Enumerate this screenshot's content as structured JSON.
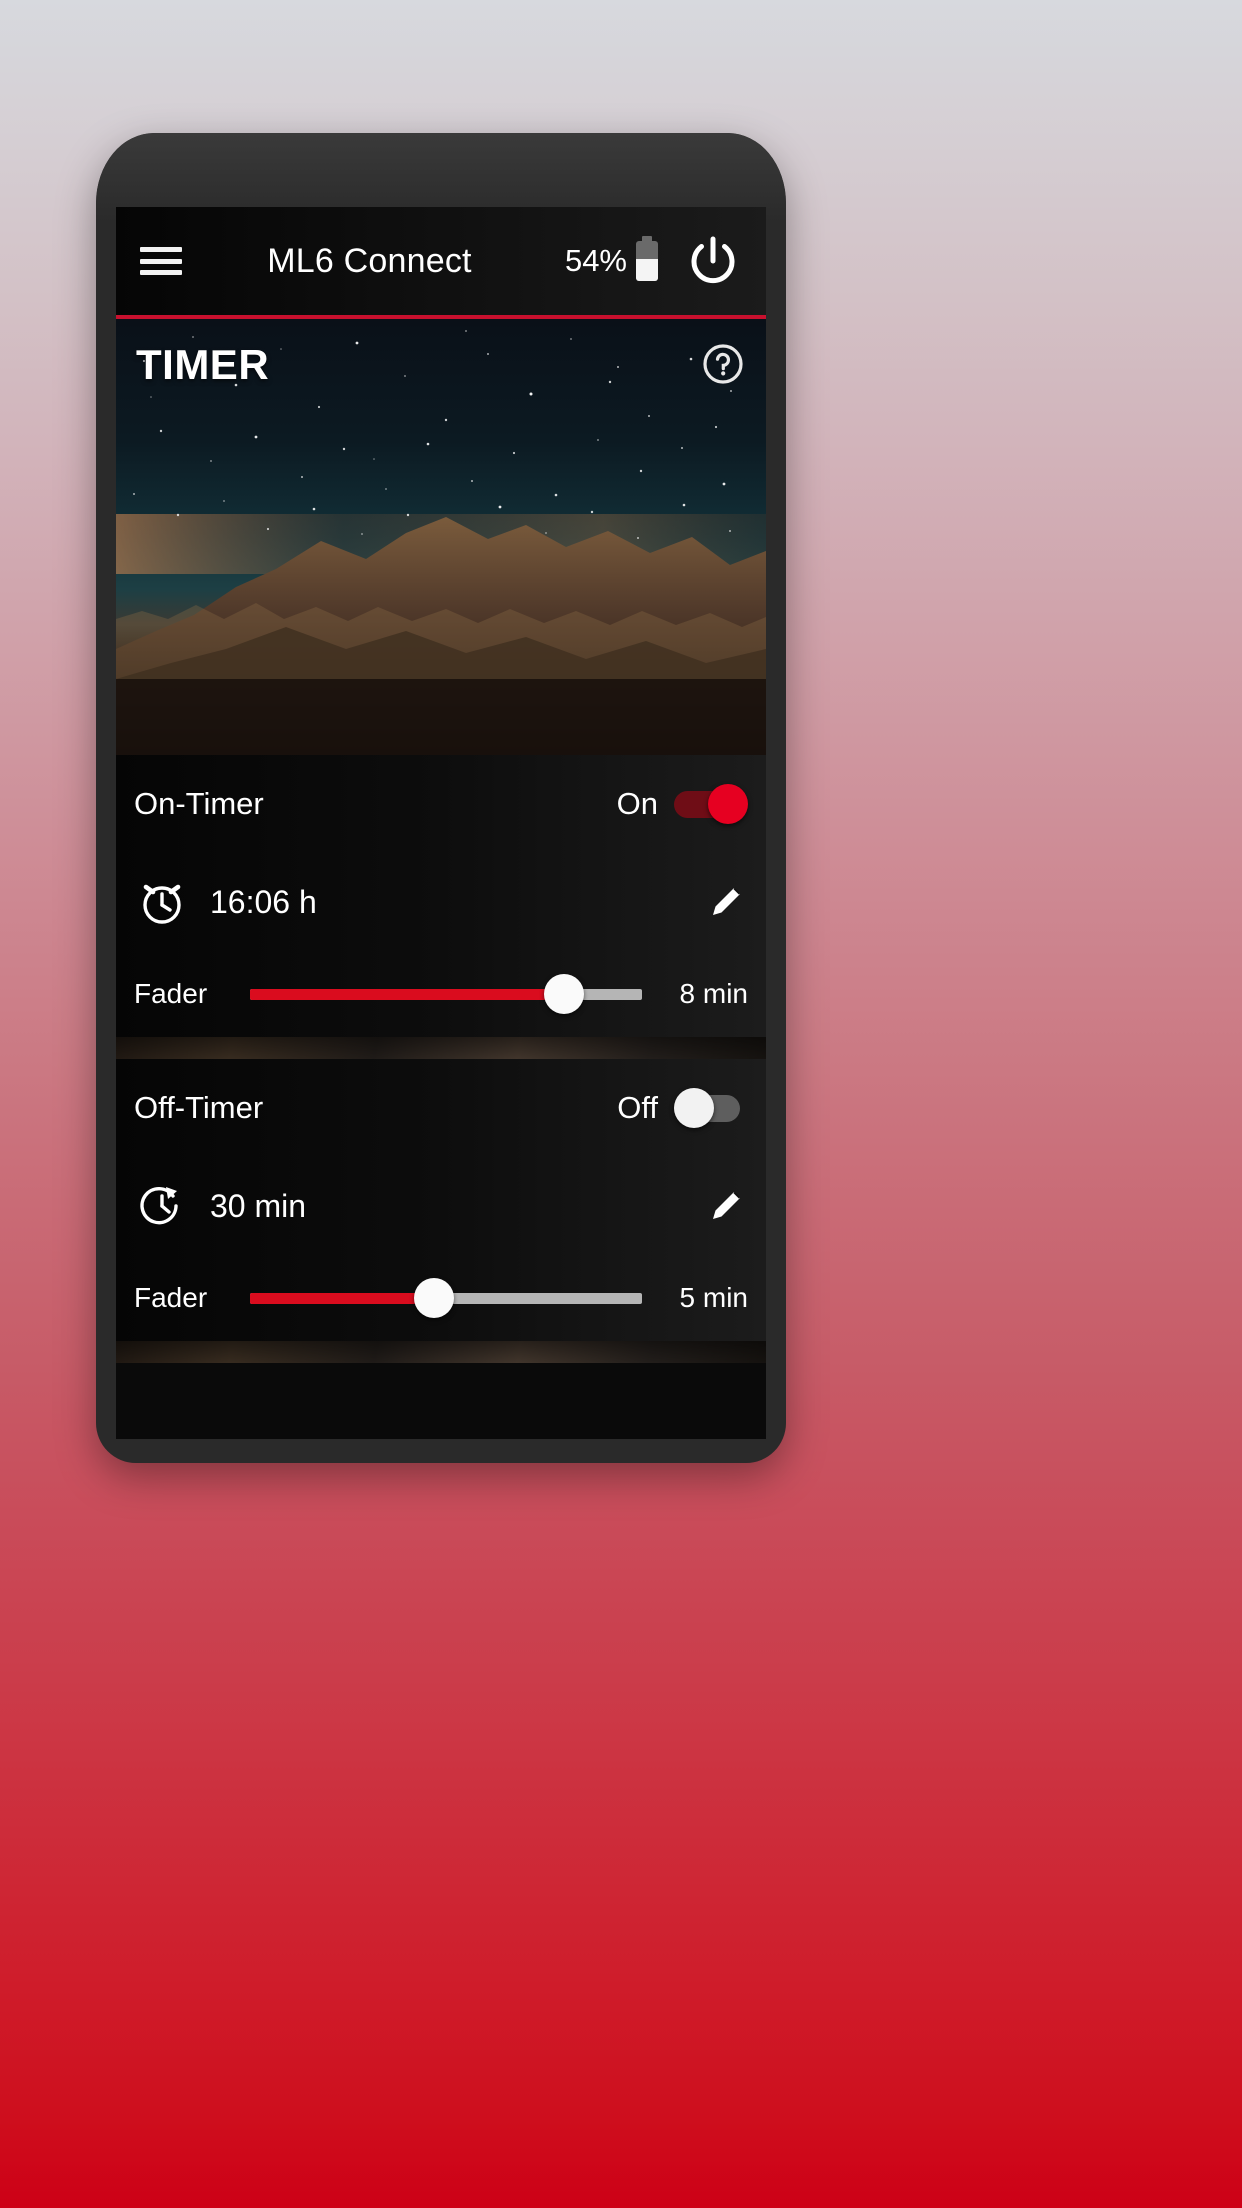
{
  "app": {
    "title": "ML6 Connect",
    "menu_icon": "hamburger-menu-icon",
    "power_icon": "power-button-icon"
  },
  "status": {
    "battery_percent_label": "54%",
    "battery_level": 54,
    "battery_icon": "battery-half-icon"
  },
  "hero": {
    "section_title": "TIMER",
    "help_icon": "help-circle-icon",
    "background": "night-sky-mountain-photo"
  },
  "colors": {
    "accent_red": "#c8102e",
    "slider_red": "#da0c1e",
    "toggle_on_thumb": "#e60021",
    "toggle_on_track": "#6f0d16",
    "toggle_off_thumb": "#f2f2f2",
    "toggle_off_track": "#5e5e5e",
    "card_background": "#0d0d0d",
    "text_primary": "#ffffff",
    "page_gradient_top": "#d7d9de",
    "page_gradient_bottom": "#cd0016"
  },
  "on_timer": {
    "title": "On-Timer",
    "toggle_state_label": "On",
    "toggle_enabled": true,
    "time_icon": "alarm-clock-icon",
    "time_value": "16:06 h",
    "edit_icon": "pencil-edit-icon",
    "fader_label": "Fader",
    "fader_value": "8 min",
    "fader_percent": 80
  },
  "off_timer": {
    "title": "Off-Timer",
    "toggle_state_label": "Off",
    "toggle_enabled": false,
    "time_icon": "countdown-timer-icon",
    "time_value": "30 min",
    "edit_icon": "pencil-edit-icon",
    "fader_label": "Fader",
    "fader_value": "5 min",
    "fader_percent": 47
  }
}
